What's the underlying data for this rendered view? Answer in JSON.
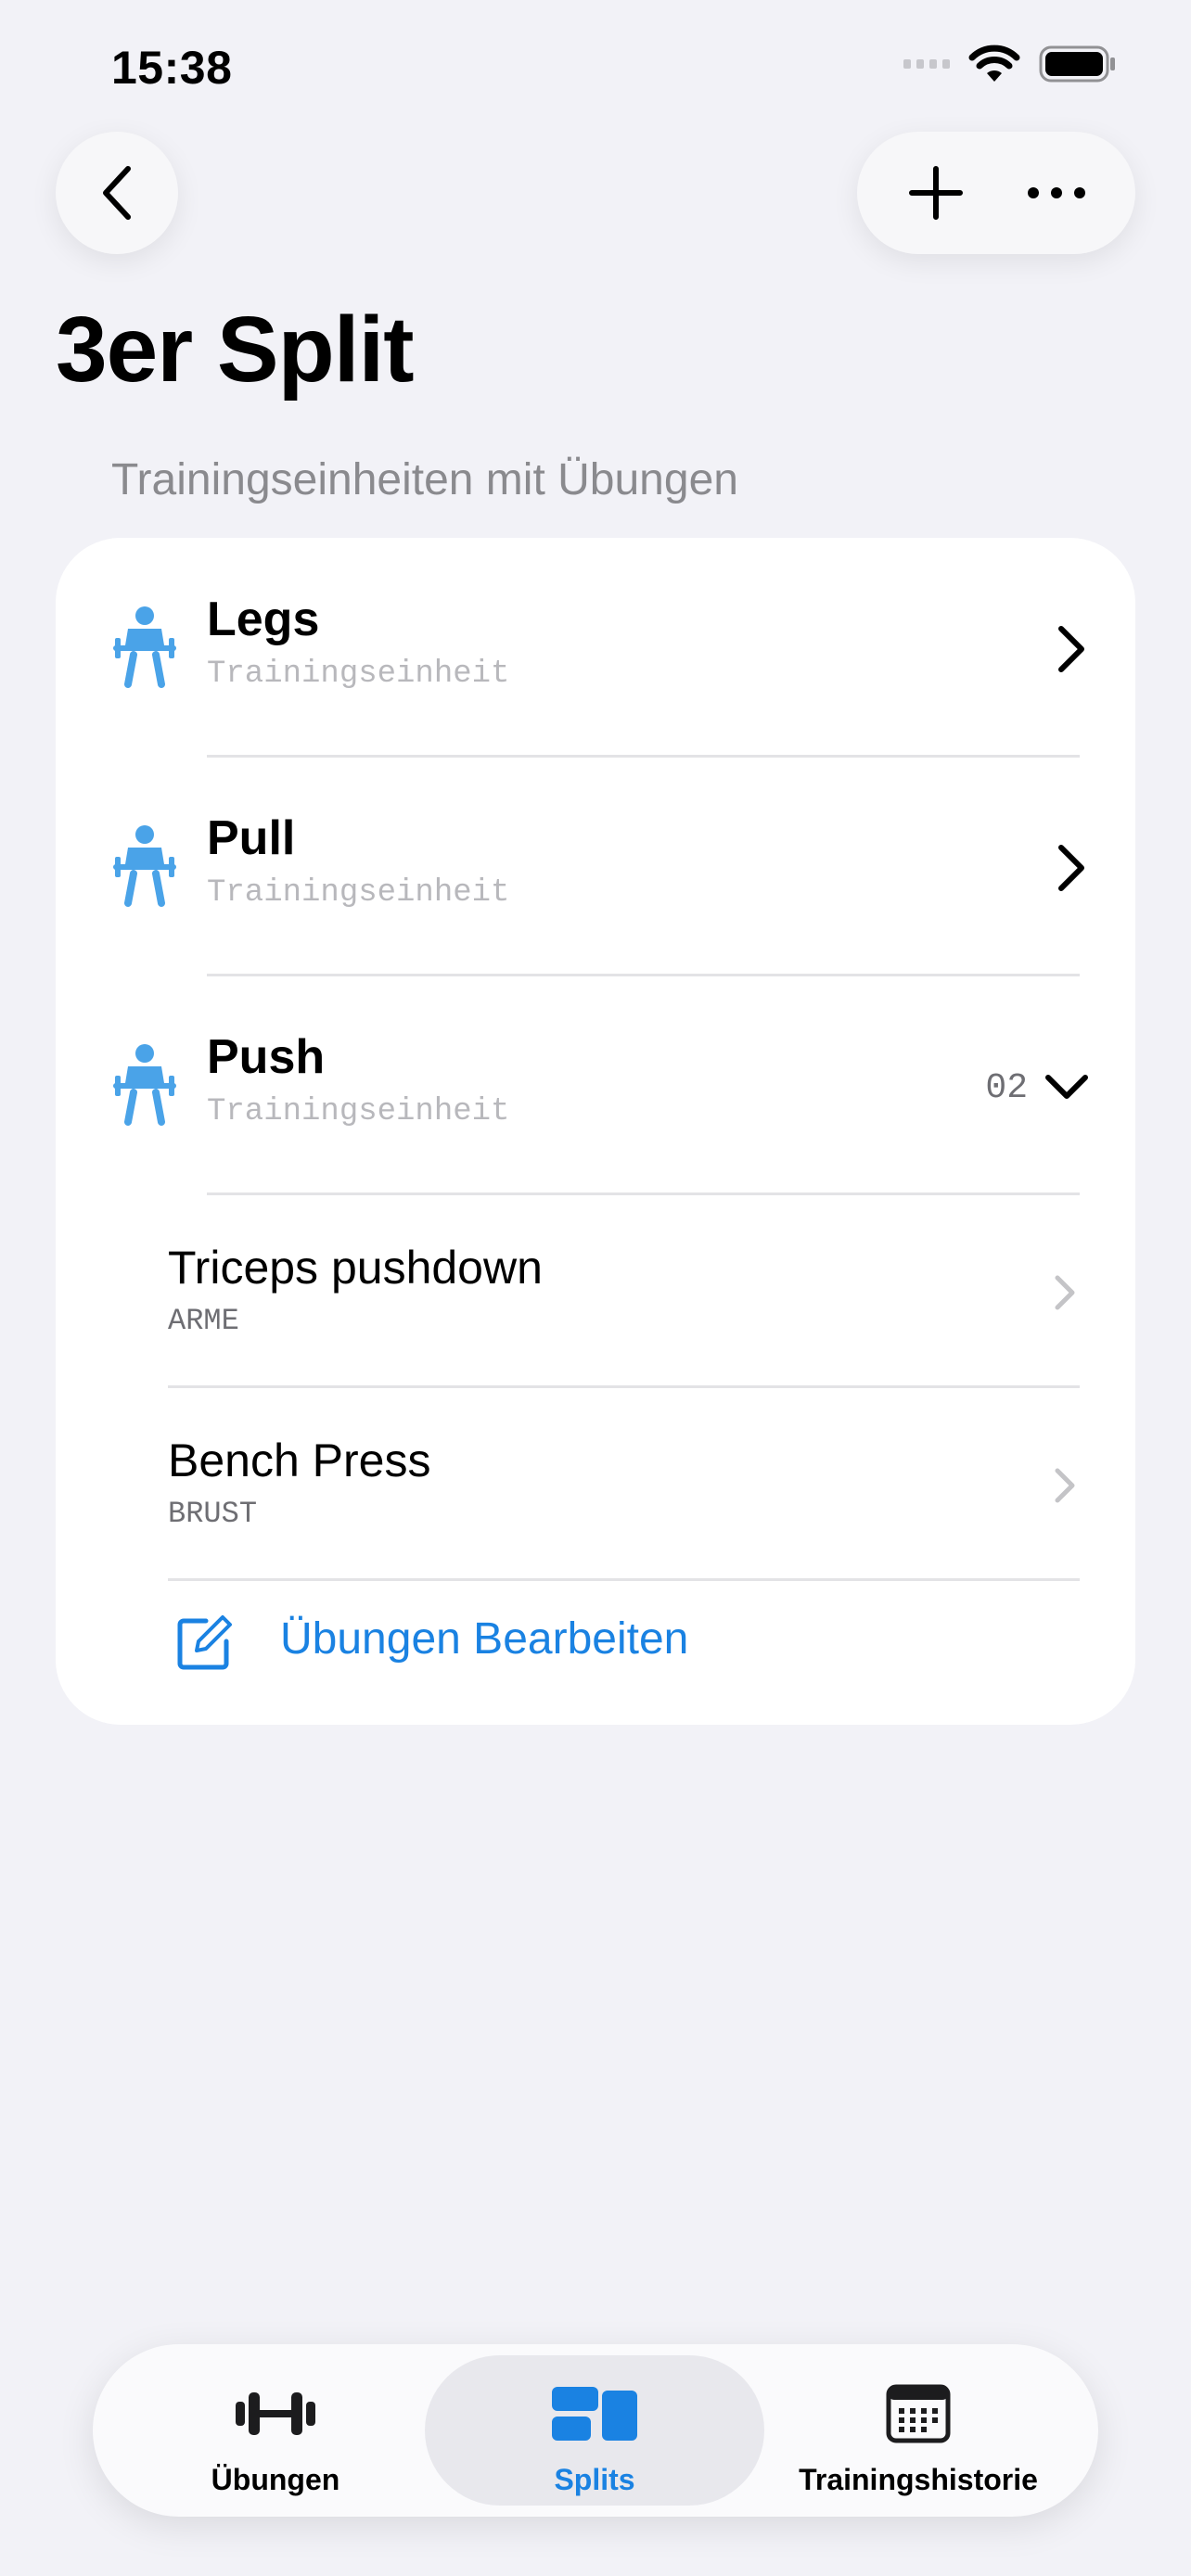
{
  "status_bar": {
    "time": "15:38"
  },
  "page": {
    "title": "3er Split",
    "section_header": "Trainingseinheiten mit Übungen"
  },
  "sessions": [
    {
      "title": "Legs",
      "subtitle": "Trainingseinheit"
    },
    {
      "title": "Pull",
      "subtitle": "Trainingseinheit"
    },
    {
      "title": "Push",
      "subtitle": "Trainingseinheit",
      "count": "02",
      "expanded": true
    }
  ],
  "exercises": [
    {
      "title": "Triceps pushdown",
      "category": "ARME"
    },
    {
      "title": "Bench Press",
      "category": "BRUST"
    }
  ],
  "edit_label": "Übungen Bearbeiten",
  "tabs": [
    {
      "label": "Übungen",
      "icon": "dumbbell-icon"
    },
    {
      "label": "Splits",
      "icon": "splits-icon",
      "active": true
    },
    {
      "label": "Trainingshistorie",
      "icon": "calendar-icon"
    }
  ],
  "colors": {
    "accent": "#1a82e2",
    "icon_blue": "#4aa3e8",
    "background": "#f2f2f7"
  }
}
